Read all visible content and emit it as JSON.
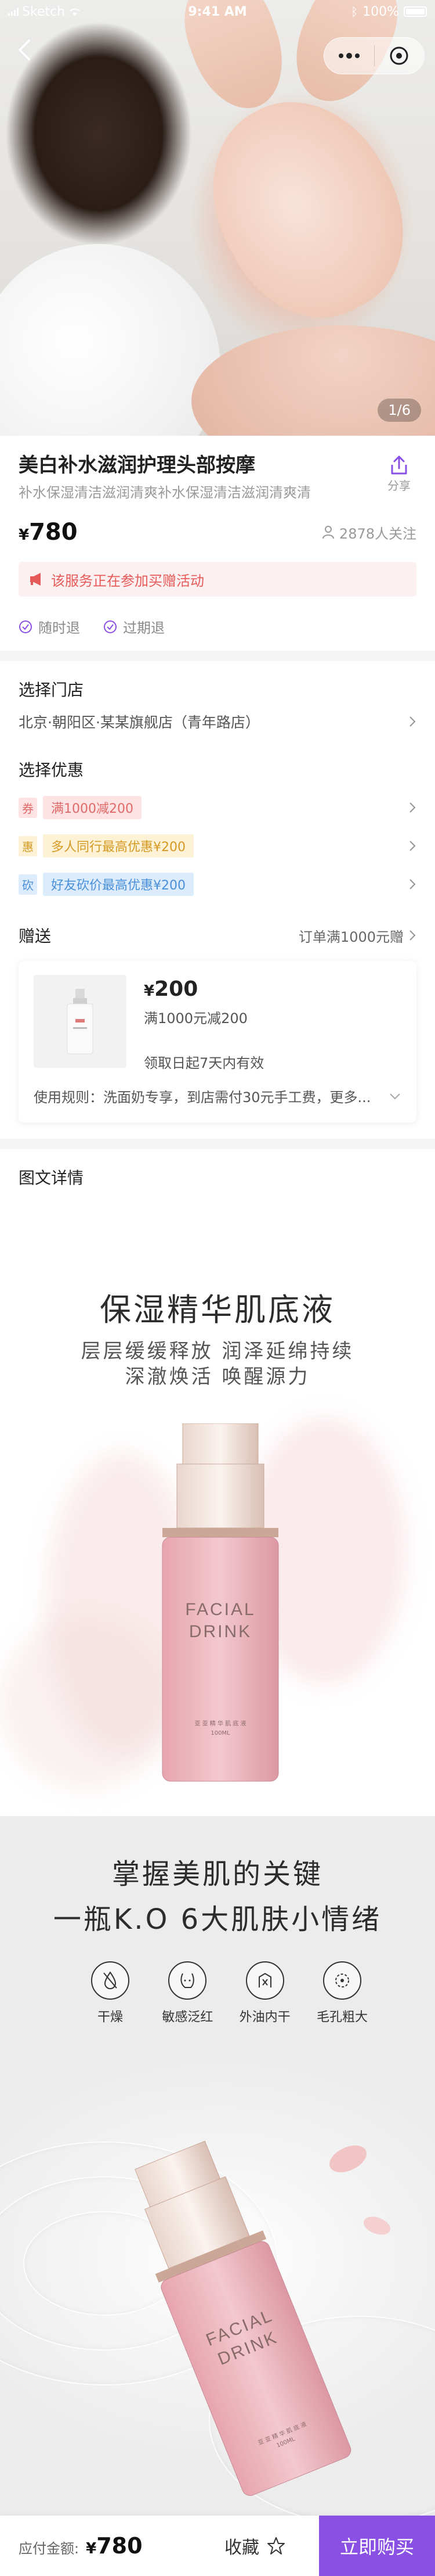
{
  "status_bar": {
    "carrier": "Sketch",
    "time": "9:41 AM",
    "battery": "100%"
  },
  "hero": {
    "pager": "1/6"
  },
  "product": {
    "title": "美白补水滋润护理头部按摩",
    "subtitle": "补水保湿清洁滋润清爽补水保湿清洁滋润清爽清",
    "share_label": "分享",
    "price_symbol": "¥",
    "price": "780",
    "followers": "2878人关注",
    "notice": "该服务正在参加买赠活动",
    "guarantees": [
      "随时退",
      "过期退"
    ]
  },
  "store": {
    "title": "选择门店",
    "value": "北京·朝阳区·某某旗舰店（青年路店）"
  },
  "coupons": {
    "title": "选择优惠",
    "items": [
      {
        "tag": "券",
        "text": "满1000减200",
        "tag_bg": "#fde3e3",
        "tag_color": "#e06a6a",
        "chip_bg": "#fde3e3",
        "chip_color": "#e06a6a"
      },
      {
        "tag": "惠",
        "text": "多人同行最高优惠¥200",
        "tag_bg": "#fdf1d6",
        "tag_color": "#d59a23",
        "chip_bg": "#fdf1d6",
        "chip_color": "#d59a23"
      },
      {
        "tag": "砍",
        "text": "好友砍价最高优惠¥200",
        "tag_bg": "#dcecfc",
        "tag_color": "#4a8fd9",
        "chip_bg": "#dcecfc",
        "chip_color": "#4a8fd9"
      }
    ]
  },
  "gift": {
    "title": "赠送",
    "requirement": "订单满1000元赠",
    "price_symbol": "¥",
    "price": "200",
    "condition": "满1000元减200",
    "validity": "领取日起7天内有效",
    "rule": "使用规则：洗面奶专享，到店需付30元手工费，更多..."
  },
  "detail": {
    "title": "图文详情",
    "panel1": {
      "headline": "保湿精华肌底液",
      "line1": "层层缓缓释放  润泽延绵持续",
      "line2": "深澈焕活  唤醒源力",
      "bottle_text": [
        "FACIAL",
        "DRINK"
      ],
      "bottle_small": [
        "亚 亚 精 华 肌 底 液",
        "100ML"
      ]
    },
    "panel2": {
      "headline1": "掌握美肌的关键",
      "headline2": "一瓶K.O 6大肌肤小情绪",
      "skin_issues": [
        {
          "icon": "water-drop-slash-icon",
          "label": "干燥"
        },
        {
          "icon": "face-sensitive-icon",
          "label": "敏感泛红"
        },
        {
          "icon": "oil-water-icon",
          "label": "外油内干"
        },
        {
          "icon": "pores-icon",
          "label": "毛孔粗大"
        }
      ],
      "bottle_text": [
        "FACIAL",
        "DRINK"
      ],
      "bottle_small": [
        "亚 亚 精 华 肌 底 液",
        "100ML"
      ]
    }
  },
  "bottom_bar": {
    "pay_label": "应付金额:",
    "price_symbol": "¥",
    "price": "780",
    "favorite_label": "收藏",
    "buy_label": "立即购买"
  },
  "colors": {
    "accent": "#8a4fe3",
    "notice_red": "#e65a5a"
  }
}
